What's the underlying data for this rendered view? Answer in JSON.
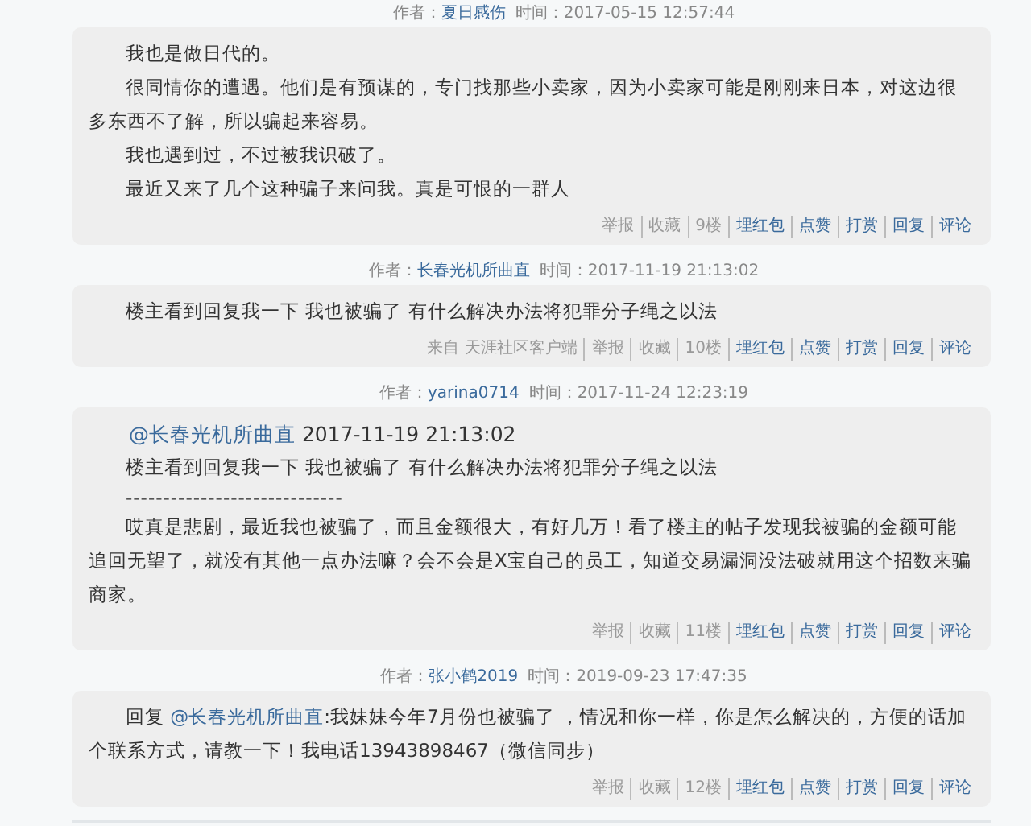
{
  "posts": [
    {
      "author": "夏日感伤",
      "time_label": "时间：2017-05-15 12:57:44",
      "author_label": "作者：",
      "paragraphs": [
        {
          "kind": "text",
          "segments": [
            {
              "text": "我也是做日代的。"
            }
          ]
        },
        {
          "kind": "text",
          "segments": [
            {
              "text": "很同情你的遭遇。他们是有预谋的，专门找那些小卖家，因为小卖家可能是刚刚来日本，对这边很多东西不了解，所以骗起来容易。"
            }
          ]
        },
        {
          "kind": "text",
          "segments": [
            {
              "text": "我也遇到过，不过被我识破了。"
            }
          ]
        },
        {
          "kind": "text",
          "segments": [
            {
              "text": "最近又来了几个这种骗子来问我。真是可恨的一群人"
            }
          ]
        }
      ],
      "actions": [
        {
          "label": "举报",
          "kind": "plain"
        },
        {
          "label": "收藏",
          "kind": "plain"
        },
        {
          "label": "9楼",
          "kind": "plain"
        },
        {
          "label": "埋红包",
          "kind": "link"
        },
        {
          "label": "点赞",
          "kind": "link"
        },
        {
          "label": "打赏",
          "kind": "link"
        },
        {
          "label": "回复",
          "kind": "link"
        },
        {
          "label": "评论",
          "kind": "link"
        }
      ]
    },
    {
      "author": "长春光机所曲直",
      "time_label": "时间：2017-11-19 21:13:02",
      "author_label": "作者：",
      "paragraphs": [
        {
          "kind": "text",
          "segments": [
            {
              "text": "楼主看到回复我一下 我也被骗了 有什么解决办法将犯罪分子绳之以法"
            }
          ]
        }
      ],
      "actions": [
        {
          "label": "来自 天涯社区客户端",
          "kind": "plain"
        },
        {
          "label": "举报",
          "kind": "plain"
        },
        {
          "label": "收藏",
          "kind": "plain"
        },
        {
          "label": "10楼",
          "kind": "plain"
        },
        {
          "label": "埋红包",
          "kind": "link"
        },
        {
          "label": "点赞",
          "kind": "link"
        },
        {
          "label": "打赏",
          "kind": "link"
        },
        {
          "label": "回复",
          "kind": "link"
        },
        {
          "label": "评论",
          "kind": "link"
        }
      ]
    },
    {
      "author": "yarina0714",
      "time_label": "时间：2017-11-24 12:23:19",
      "author_label": "作者：",
      "paragraphs": [
        {
          "kind": "quote_head",
          "segments": [
            {
              "text": "@长春光机所曲直",
              "link": true
            },
            {
              "text": " 2017-11-19 21:13:02"
            }
          ]
        },
        {
          "kind": "quote",
          "segments": [
            {
              "text": "楼主看到回复我一下 我也被骗了 有什么解决办法将犯罪分子绳之以法"
            }
          ]
        },
        {
          "kind": "divider",
          "segments": [
            {
              "text": "-----------------------------"
            }
          ]
        },
        {
          "kind": "text",
          "segments": [
            {
              "text": "哎真是悲剧，最近我也被骗了，而且金额很大，有好几万！看了楼主的帖子发现我被骗的金额可能追回无望了，就没有其他一点办法嘛？会不会是X宝自己的员工，知道交易漏洞没法破就用这个招数来骗商家。"
            }
          ]
        }
      ],
      "actions": [
        {
          "label": "举报",
          "kind": "plain"
        },
        {
          "label": "收藏",
          "kind": "plain"
        },
        {
          "label": "11楼",
          "kind": "plain"
        },
        {
          "label": "埋红包",
          "kind": "link"
        },
        {
          "label": "点赞",
          "kind": "link"
        },
        {
          "label": "打赏",
          "kind": "link"
        },
        {
          "label": "回复",
          "kind": "link"
        },
        {
          "label": "评论",
          "kind": "link"
        }
      ]
    },
    {
      "author": "张小鹤2019",
      "time_label": "时间：2019-09-23 17:47:35",
      "author_label": "作者：",
      "paragraphs": [
        {
          "kind": "text",
          "segments": [
            {
              "text": "回复 "
            },
            {
              "text": "@长春光机所曲直",
              "link": true
            },
            {
              "text": ":我妹妹今年7月份也被骗了 ，情况和你一样，你是怎么解决的，方便的话加个联系方式，请教一下！我电话13943898467（微信同步）"
            }
          ]
        }
      ],
      "actions": [
        {
          "label": "举报",
          "kind": "plain"
        },
        {
          "label": "收藏",
          "kind": "plain"
        },
        {
          "label": "12楼",
          "kind": "plain"
        },
        {
          "label": "埋红包",
          "kind": "link"
        },
        {
          "label": "点赞",
          "kind": "link"
        },
        {
          "label": "打赏",
          "kind": "link"
        },
        {
          "label": "回复",
          "kind": "link"
        },
        {
          "label": "评论",
          "kind": "link"
        }
      ]
    }
  ]
}
